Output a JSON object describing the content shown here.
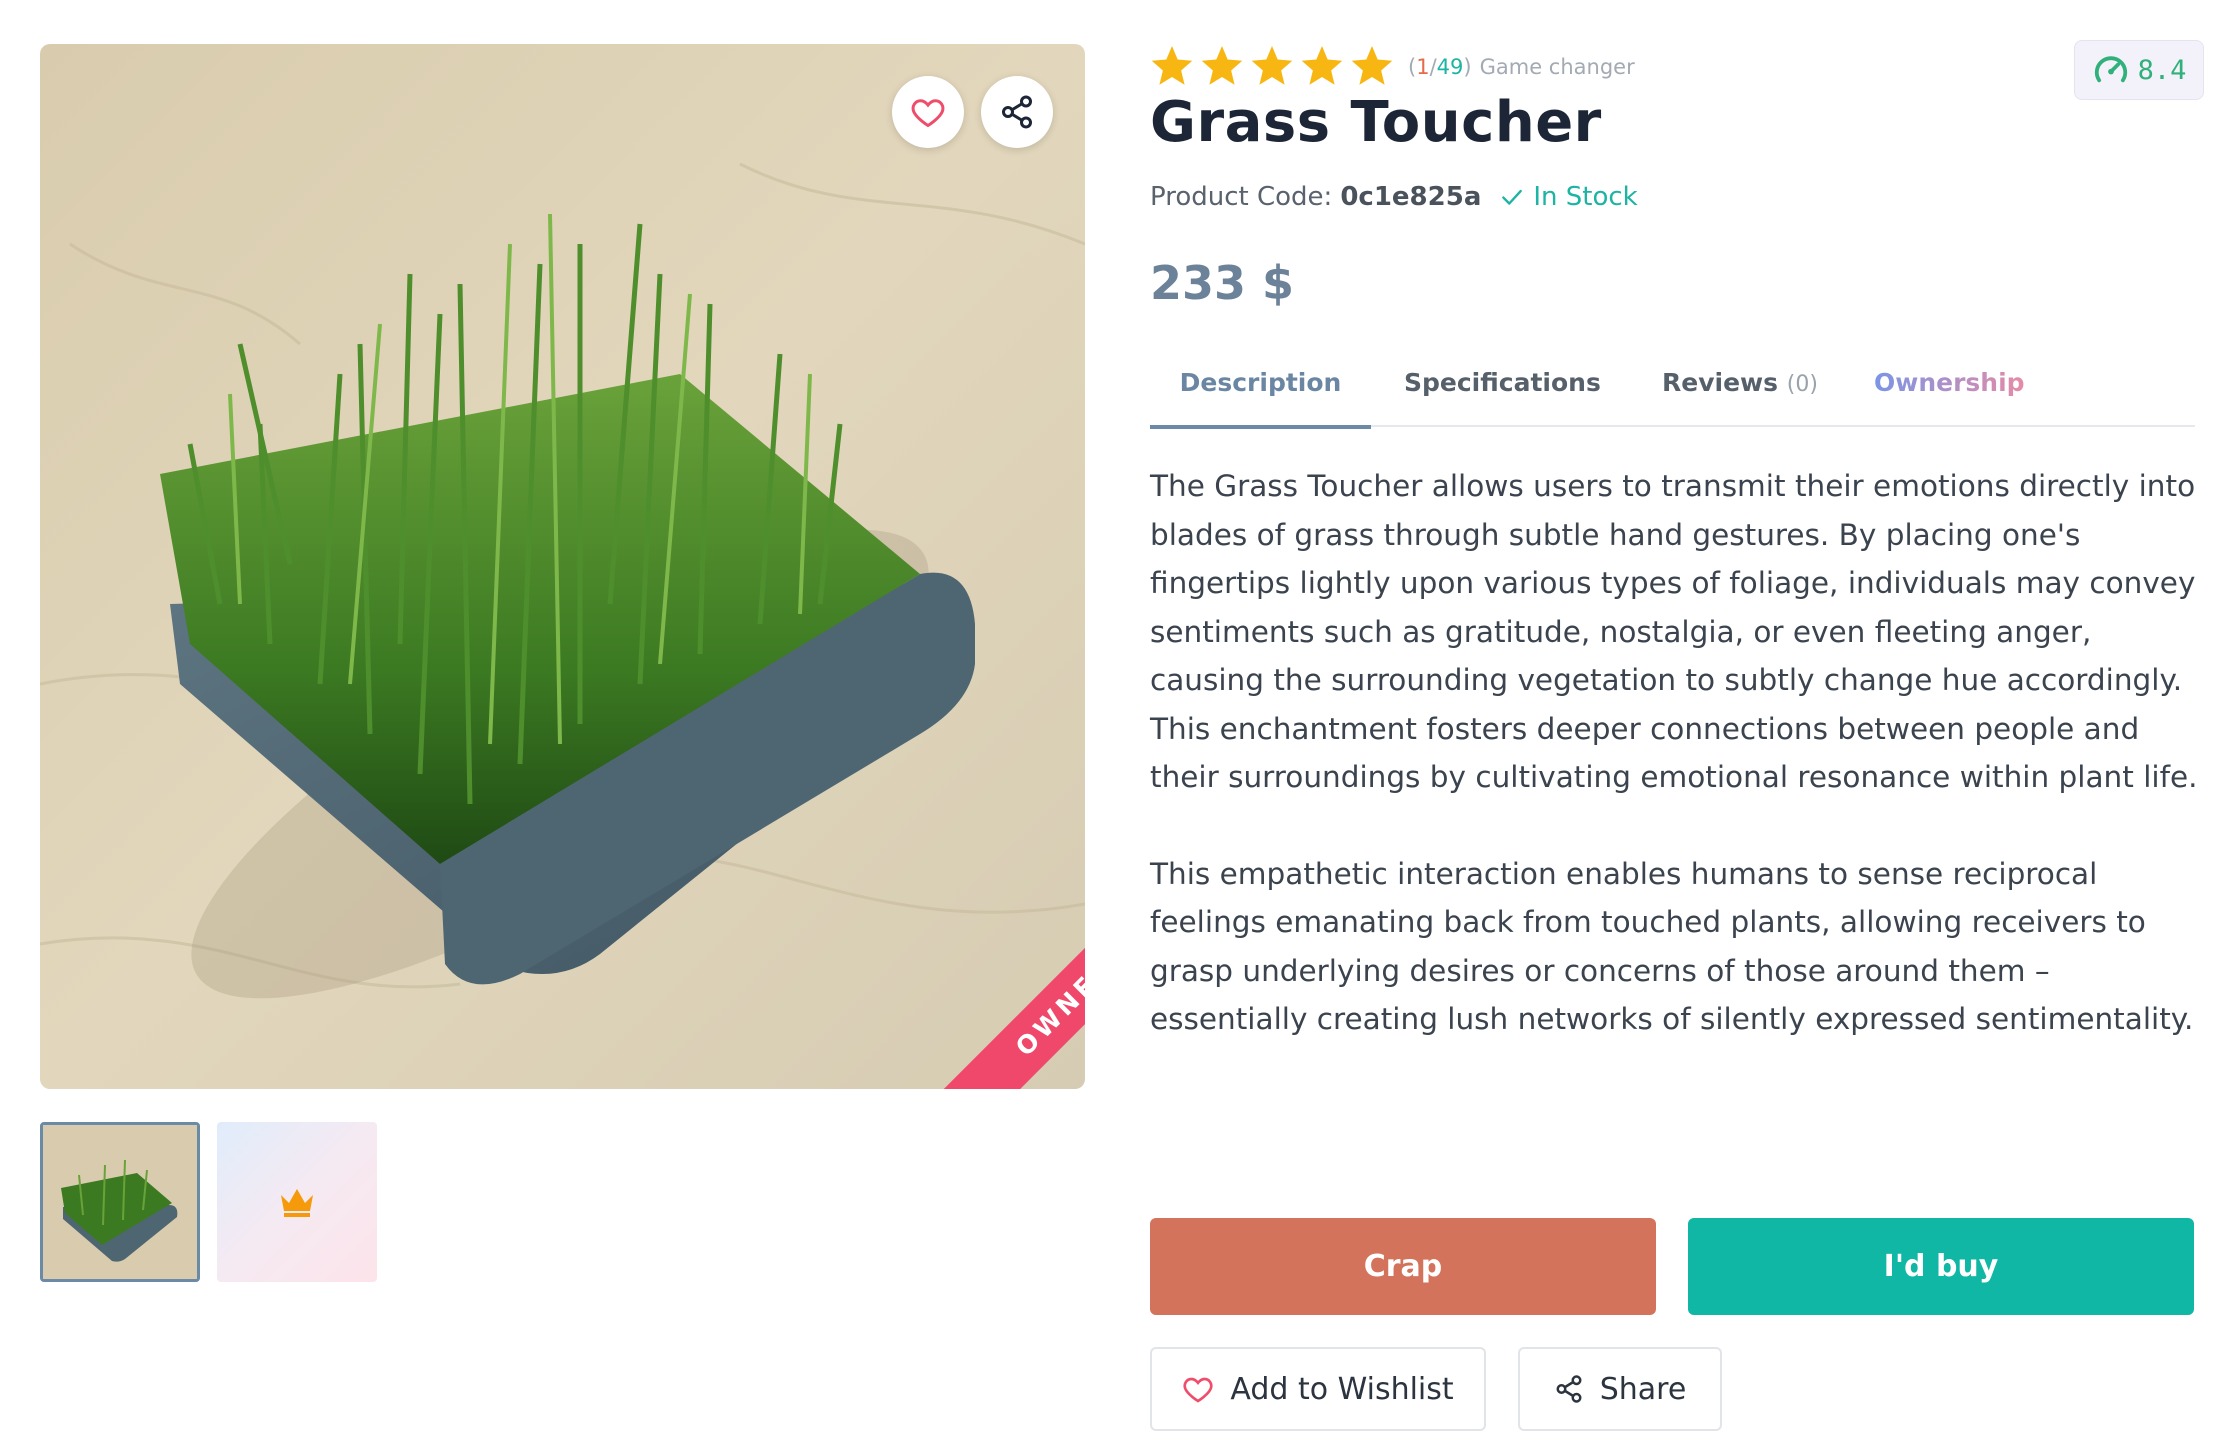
{
  "gallery": {
    "ribbon_text": "OWNED",
    "main_image": "grass-on-slate-tray-photo",
    "thumbnails": [
      "grass-tray-thumbnail",
      "crown-placeholder-thumbnail"
    ],
    "selected_thumbnail": 0
  },
  "rating": {
    "stars": 5,
    "count_open": "(",
    "current": "1",
    "separator": "/",
    "total": "49",
    "count_close": ")",
    "label": "Game changer"
  },
  "score": {
    "icon": "speedometer-icon",
    "value": "8.4"
  },
  "product": {
    "title": "Grass Toucher",
    "code_label": "Product Code:",
    "code_value": "0c1e825a",
    "stock": "In Stock",
    "price": "233 $"
  },
  "tabs": {
    "description": "Description",
    "specifications": "Specifications",
    "reviews": "Reviews",
    "reviews_count": "(0)",
    "ownership": "Ownership",
    "active": "description"
  },
  "description": {
    "p1": "The Grass Toucher allows users to transmit their emotions directly into blades of grass through subtle hand gestures. By placing one's fingertips lightly upon various types of foliage, individuals may convey sentiments such as gratitude, nostalgia, or even fleeting anger, causing the surrounding vegetation to subtly change hue accordingly. This enchantment fosters deeper connections between people and their surroundings by cultivating emotional resonance within plant life.",
    "p2": "This empathetic interaction enables humans to sense reciprocal feelings emanating back from touched plants, allowing receivers to grasp underlying desires or concerns of those around them – essentially creating lush networks of silently expressed sentimentality."
  },
  "actions": {
    "crap": "Crap",
    "buy": "I'd buy",
    "wishlist": "Add to Wishlist",
    "share": "Share"
  },
  "colors": {
    "accent": "#6a8aa6",
    "crap": "#d4735b",
    "buy": "#0fb7a4",
    "stock": "#1db4a4",
    "ribbon": "#f0486b",
    "star": "#f8b612",
    "score": "#30b07a"
  }
}
